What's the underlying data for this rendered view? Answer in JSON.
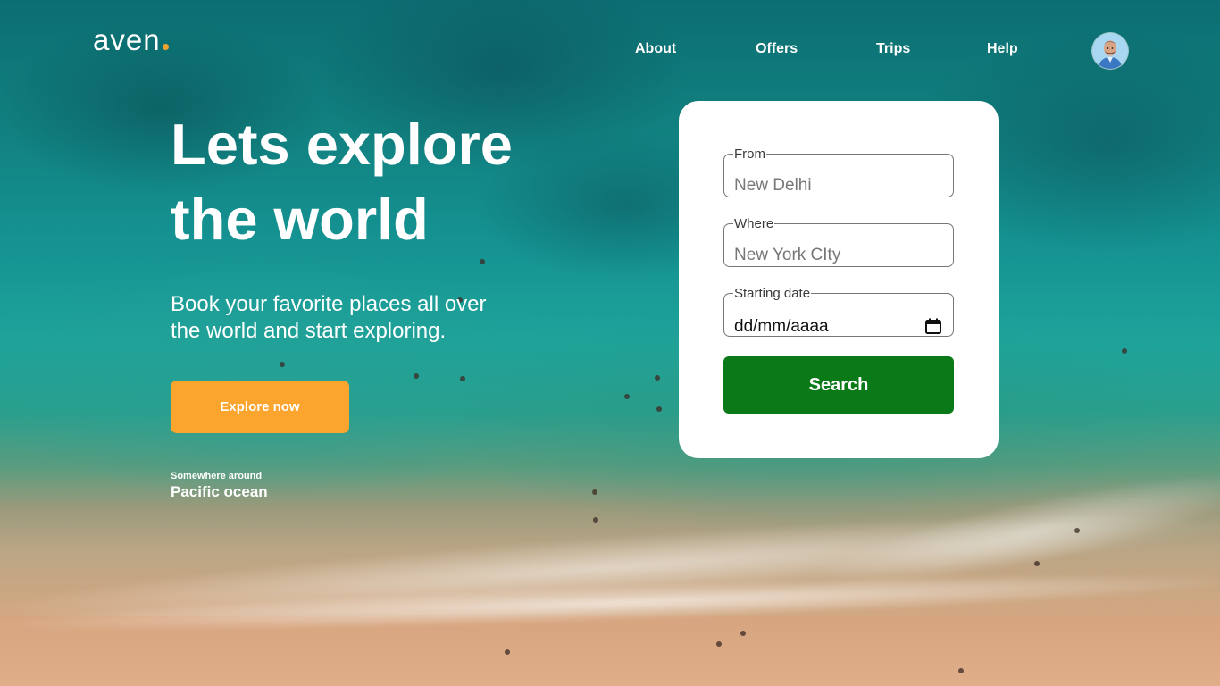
{
  "brand": {
    "name": "aven",
    "dot_color": "#f4a22d"
  },
  "nav": {
    "items": [
      "About",
      "Offers",
      "Trips",
      "Help"
    ]
  },
  "user": {
    "avatar_icon": "user-avatar"
  },
  "hero": {
    "title_line1": "Lets explore",
    "title_line2": "the world",
    "subtitle_line1": "Book your favorite places all over",
    "subtitle_line2": "the world and start exploring.",
    "cta_label": "Explore now",
    "cta_color": "#fba42e",
    "location_caption": "Somewhere around",
    "location_name": "Pacific ocean"
  },
  "search_form": {
    "from": {
      "label": "From",
      "placeholder": "New Delhi"
    },
    "where": {
      "label": "Where",
      "placeholder": "New York CIty"
    },
    "date": {
      "label": "Starting date",
      "placeholder": "dd/mm/aaaa",
      "icon": "calendar-icon"
    },
    "submit_label": "Search",
    "submit_color": "#0a7a19"
  }
}
